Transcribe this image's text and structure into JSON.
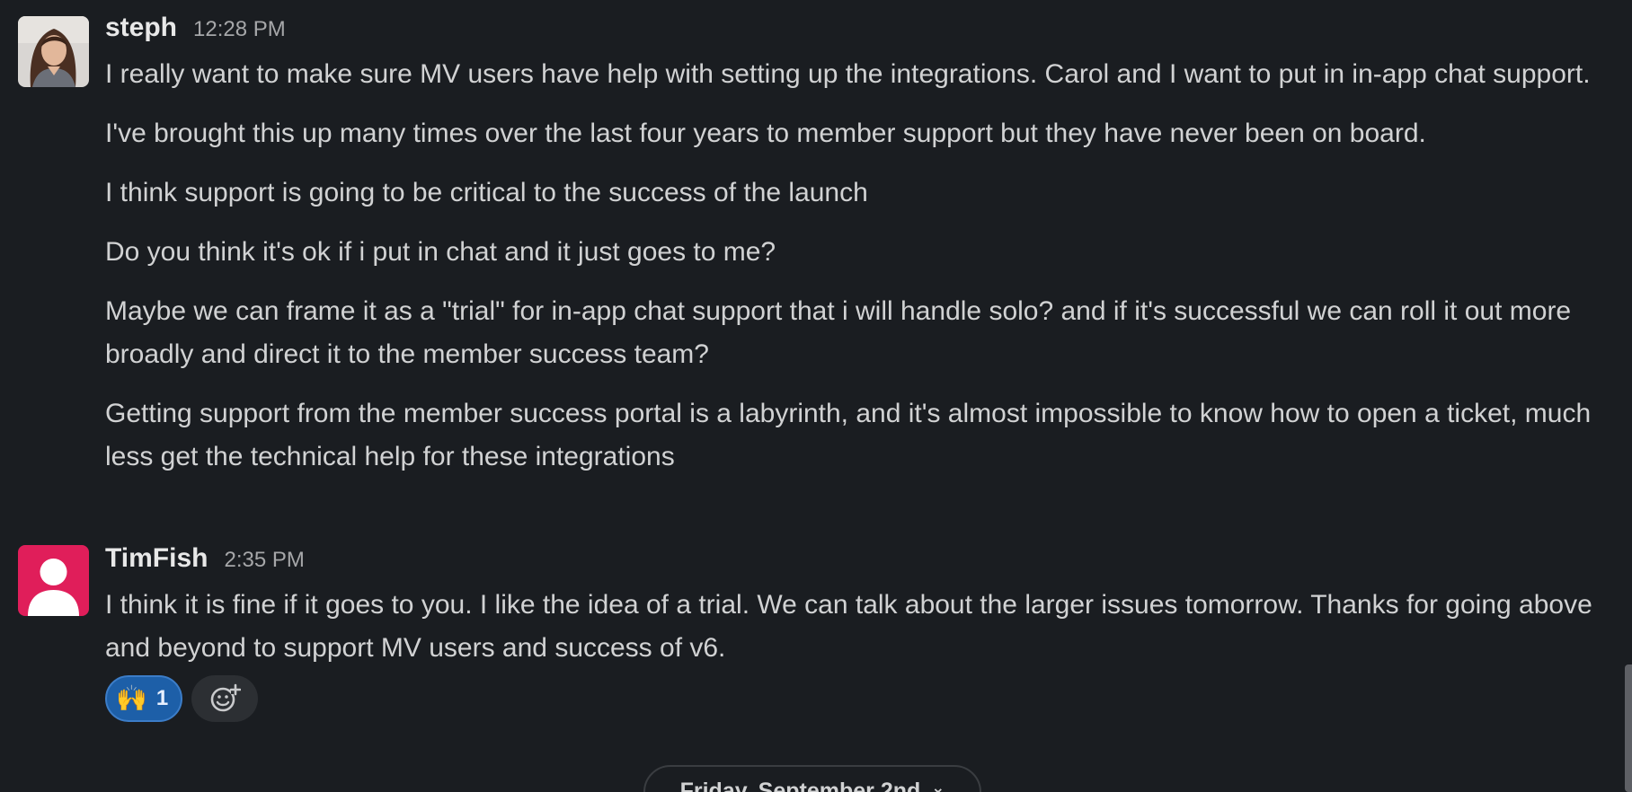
{
  "messages": [
    {
      "username": "steph",
      "timestamp": "12:28 PM",
      "paragraphs": [
        "I really want to make sure MV users have help with setting up the integrations. Carol and I want to put in in-app chat support.",
        "I've brought this up many times over the last four years to member support but they have never been on board.",
        "I think support is going to be critical to the success of the launch",
        "Do you think it's ok if i put in chat and it just goes to me?",
        "Maybe we can frame it as a \"trial\" for in-app chat support that i will handle solo? and if it's successful we can roll it out more broadly and direct it to the member success team?",
        "Getting support from the member success portal is a labyrinth, and it's almost impossible to know how to open a ticket, much less get the technical help for these integrations"
      ]
    },
    {
      "username": "TimFish",
      "timestamp": "2:35 PM",
      "paragraphs": [
        "I think it is fine if it goes to you.  I like the idea of a trial.  We can talk about the larger issues tomorrow.  Thanks for going above and beyond to support MV users and success of v6."
      ],
      "reactions": [
        {
          "emoji": "🙌",
          "count": "1",
          "icon": "raising-hands-emoji"
        }
      ],
      "add_reaction_icon": "add-reaction-icon"
    }
  ],
  "date_divider": {
    "label": "Friday, September 2nd",
    "icon": "chevron-down-icon"
  },
  "colors": {
    "background": "#1a1d21",
    "text": "#d1d2d3",
    "reaction_active": "#1d5fa8",
    "tim_avatar": "#e01e5a"
  }
}
